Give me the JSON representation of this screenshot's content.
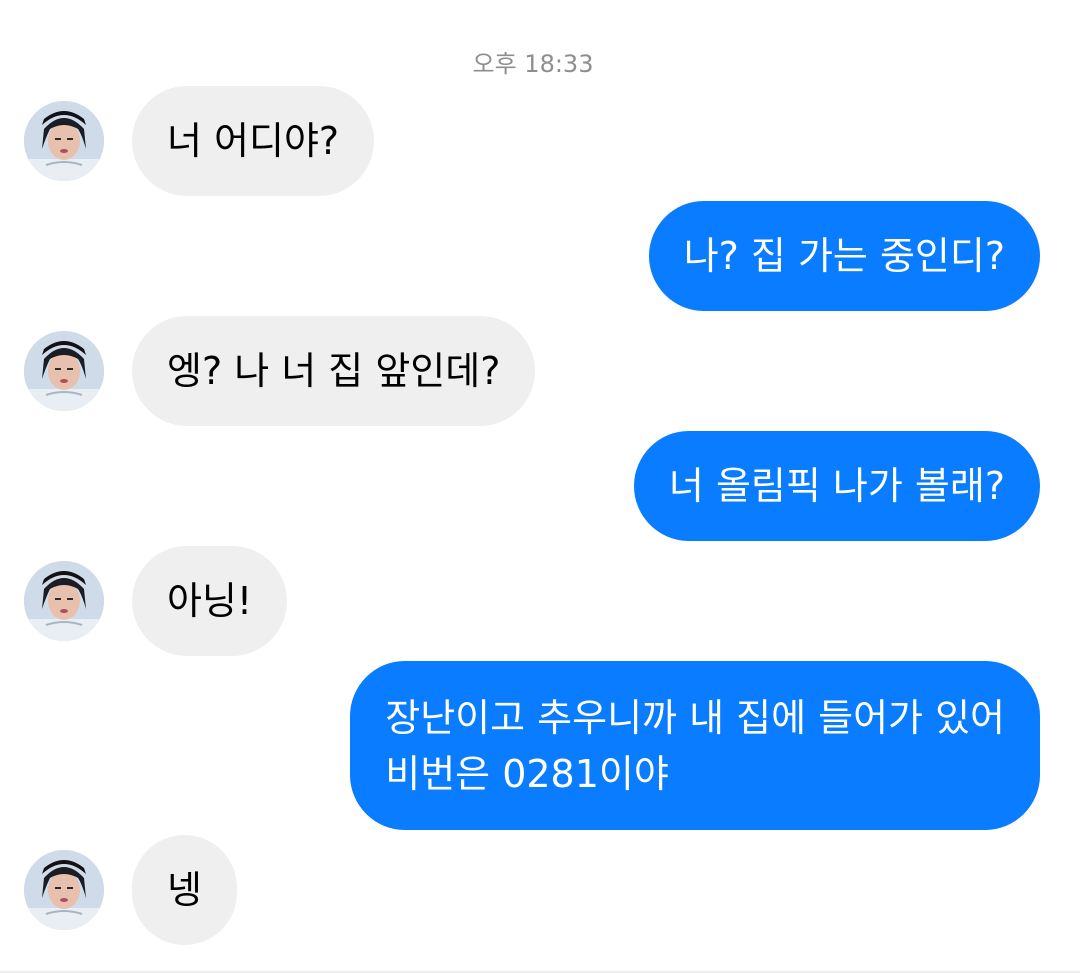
{
  "header": {
    "timestamp": "오후 18:33"
  },
  "colors": {
    "incoming_bubble": "#efefef",
    "outgoing_bubble": "#0a7cff",
    "outgoing_text": "#ffffff",
    "timestamp_text": "#8e8e8e"
  },
  "messages": [
    {
      "sender": "contact",
      "text": "너 어디야?"
    },
    {
      "sender": "me",
      "text": "나? 집 가는 중인디?"
    },
    {
      "sender": "contact",
      "text": "엥? 나 너 집 앞인데?"
    },
    {
      "sender": "me",
      "text": "너 올림픽 나가 볼래?"
    },
    {
      "sender": "contact",
      "text": "아닝!"
    },
    {
      "sender": "me",
      "text": "장난이고 추우니까 내 집에 들어가 있어\n비번은 0281이야"
    },
    {
      "sender": "contact",
      "text": "넹"
    }
  ]
}
